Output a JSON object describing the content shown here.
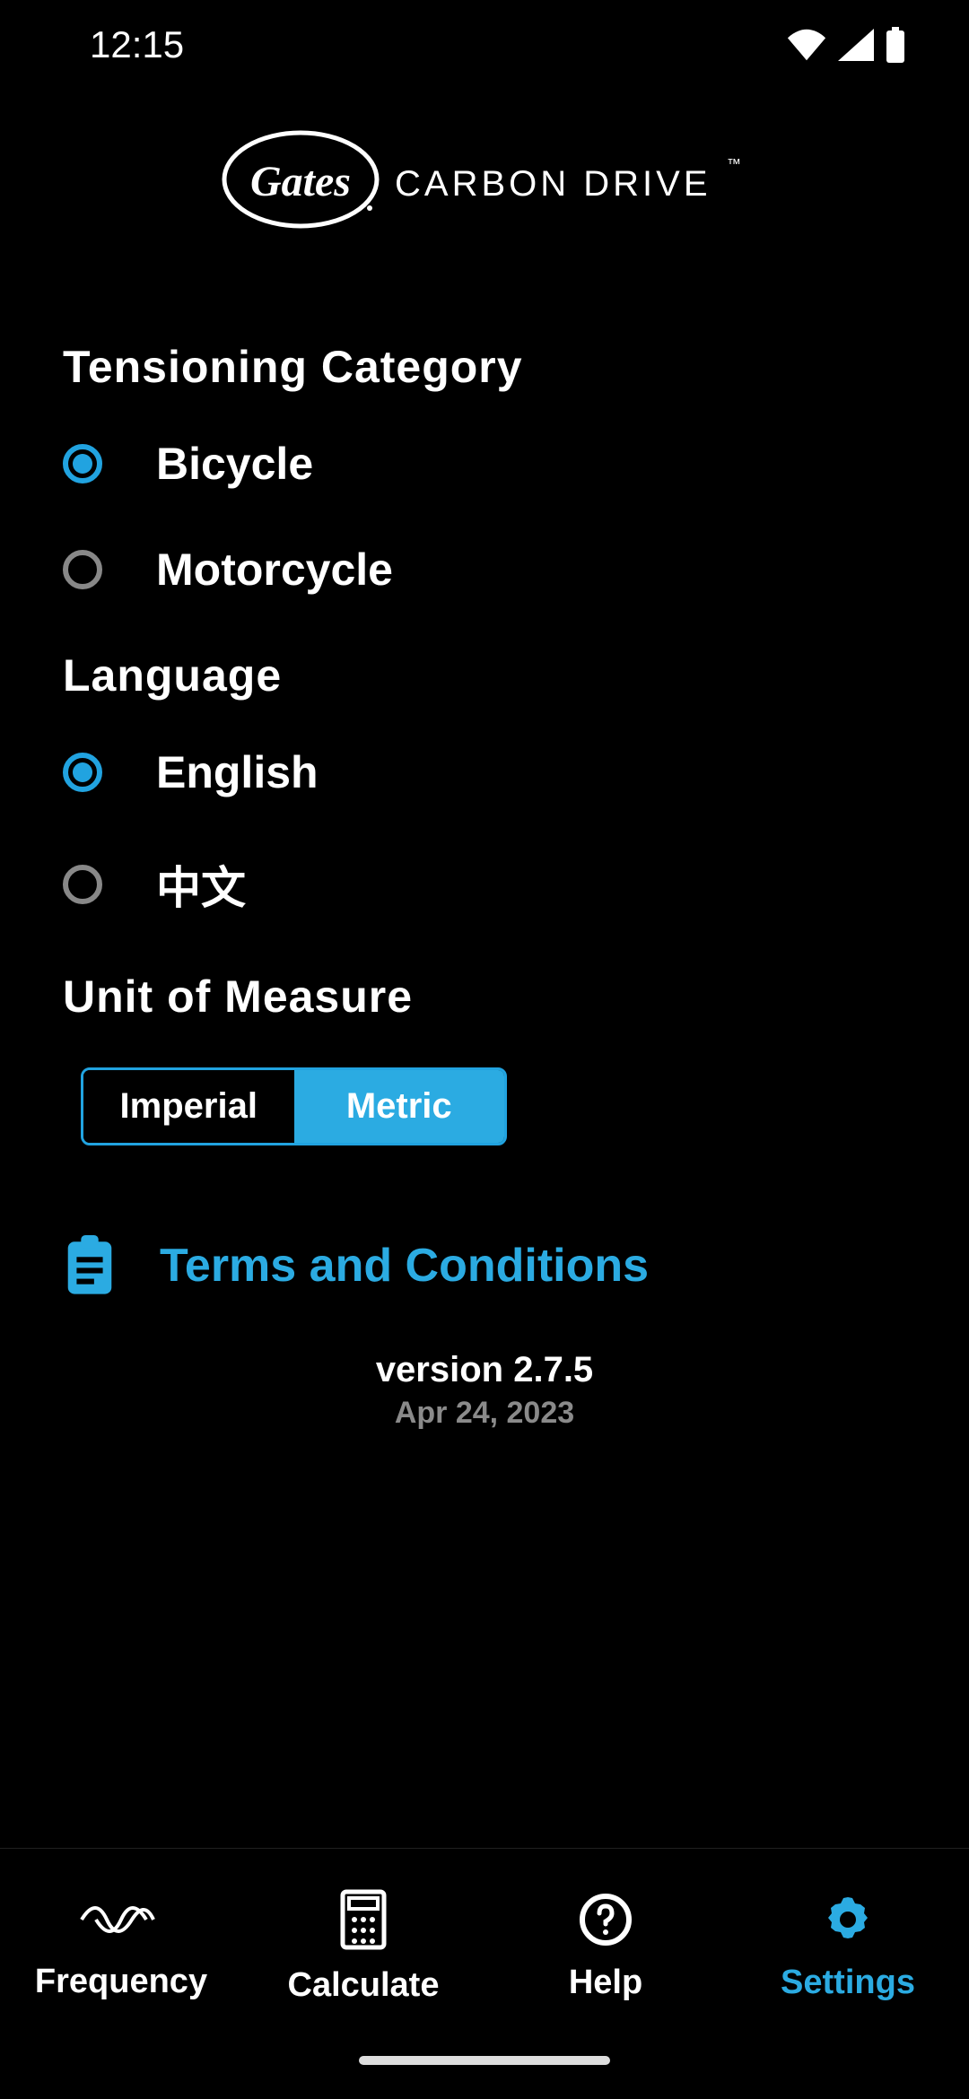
{
  "status": {
    "time": "12:15"
  },
  "brand": {
    "name": "CARBON DRIVE"
  },
  "sections": {
    "tensioning": {
      "title": "Tensioning Category",
      "options": [
        {
          "label": "Bicycle",
          "selected": true
        },
        {
          "label": "Motorcycle",
          "selected": false
        }
      ]
    },
    "language": {
      "title": "Language",
      "options": [
        {
          "label": "English",
          "selected": true
        },
        {
          "label": "中文",
          "selected": false
        }
      ]
    },
    "unit": {
      "title": "Unit of Measure",
      "options": [
        {
          "label": "Imperial",
          "selected": false
        },
        {
          "label": "Metric",
          "selected": true
        }
      ]
    }
  },
  "terms": {
    "label": "Terms and Conditions"
  },
  "version": {
    "text": "version 2.7.5",
    "date": "Apr 24, 2023"
  },
  "tabs": [
    {
      "label": "Frequency",
      "active": false
    },
    {
      "label": "Calculate",
      "active": false
    },
    {
      "label": "Help",
      "active": false
    },
    {
      "label": "Settings",
      "active": true
    }
  ]
}
